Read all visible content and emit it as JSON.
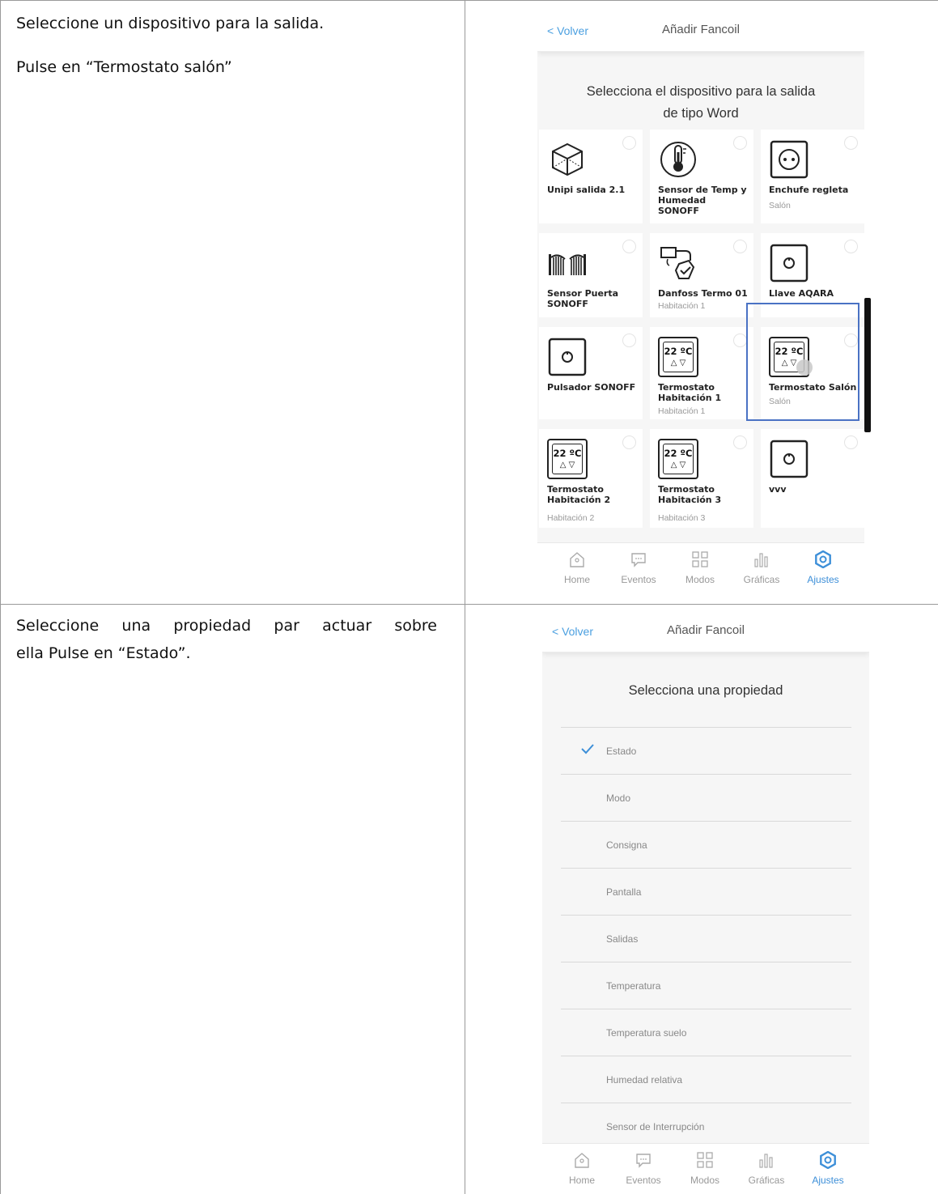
{
  "document": {
    "step1": {
      "line1": "Seleccione un dispositivo para la salida.",
      "line2": "Pulse en “Termostato salón”"
    },
    "step2": {
      "line1": "Seleccione una propiedad par actuar sobre",
      "line2": "ella Pulse en “Estado”."
    }
  },
  "screen1": {
    "back": "< Volver",
    "title": "Añadir Fancoil",
    "heading_line1": "Selecciona el dispositivo para la salida",
    "heading_line2": "de tipo Word",
    "devices": [
      {
        "name": "Unipi salida 2.1",
        "room": "",
        "icon": "cube-icon"
      },
      {
        "name": "Sensor de Temp y Humedad SONOFF",
        "room": "",
        "icon": "thermometer-icon"
      },
      {
        "name": "Enchufe regleta",
        "room": "Salón",
        "icon": "socket-icon"
      },
      {
        "name": "Sensor Puerta SONOFF",
        "room": "",
        "icon": "gate-icon"
      },
      {
        "name": "Danfoss Termo 01",
        "room": "Habitación 1",
        "icon": "valve-icon"
      },
      {
        "name": "Llave AQARA",
        "room": "",
        "icon": "switch-icon"
      },
      {
        "name": "Pulsador SONOFF",
        "room": "",
        "icon": "switch-icon"
      },
      {
        "name": "Termostato Habitación 1",
        "room": "Habitación 1",
        "icon": "thermostat-icon",
        "temp": "22 ºC",
        "arrows": "△ ▽"
      },
      {
        "name": "Termostato Salón",
        "room": "Salón",
        "icon": "thermostat-icon",
        "temp": "22 ºC",
        "arrows": "△ ▽"
      },
      {
        "name": "Termostato Habitación 2",
        "room": "Habitación 2",
        "icon": "thermostat-icon",
        "temp": "22 ºC",
        "arrows": "△ ▽"
      },
      {
        "name": "Termostato Habitación 3",
        "room": "Habitación 3",
        "icon": "thermostat-icon",
        "temp": "22 ºC",
        "arrows": "△ ▽"
      },
      {
        "name": "vvv",
        "room": "",
        "icon": "switch-icon"
      }
    ],
    "tabs": [
      "Home",
      "Eventos",
      "Modos",
      "Gráficas",
      "Ajustes"
    ],
    "active_tab": "Ajustes"
  },
  "screen2": {
    "back": "< Volver",
    "title": "Añadir Fancoil",
    "heading": "Selecciona una propiedad",
    "properties": [
      "Estado",
      "Modo",
      "Consigna",
      "Pantalla",
      "Salidas",
      "Temperatura",
      "Temperatura suelo",
      "Humedad relativa",
      "Sensor de Interrupción"
    ],
    "selected": "Estado",
    "tabs": [
      "Home",
      "Eventos",
      "Modos",
      "Gráficas",
      "Ajustes"
    ],
    "active_tab": "Ajustes"
  },
  "colors": {
    "accent": "#3d8fd8",
    "highlight": "#4a72c4",
    "grid_line": "#9a9a9a"
  }
}
